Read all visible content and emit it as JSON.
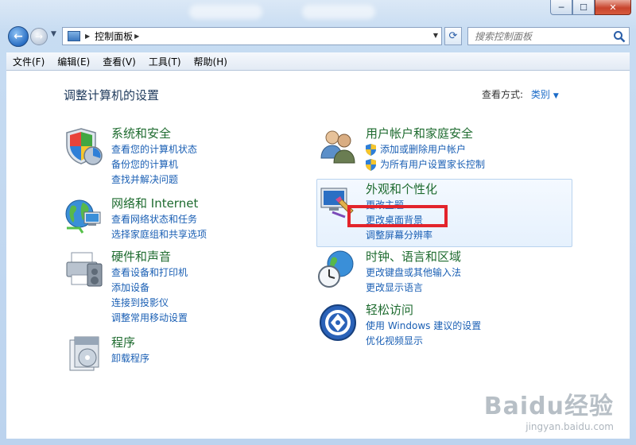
{
  "window": {
    "controls": {
      "minimize": "─",
      "maximize": "☐",
      "close": "✕"
    }
  },
  "address_bar": {
    "crumb": "控制面板",
    "search_placeholder": "搜索控制面板"
  },
  "menu": [
    "文件(F)",
    "编辑(E)",
    "查看(V)",
    "工具(T)",
    "帮助(H)"
  ],
  "page": {
    "title": "调整计算机的设置",
    "view_by_label": "查看方式:",
    "view_by_value": "类别"
  },
  "categories_left": [
    {
      "title": "系统和安全",
      "icon": "shield-security-icon",
      "links": [
        "查看您的计算机状态",
        "备份您的计算机",
        "查找并解决问题"
      ]
    },
    {
      "title": "网络和 Internet",
      "icon": "network-globe-icon",
      "links": [
        "查看网络状态和任务",
        "选择家庭组和共享选项"
      ]
    },
    {
      "title": "硬件和声音",
      "icon": "printer-hardware-icon",
      "links": [
        "查看设备和打印机",
        "添加设备",
        "连接到投影仪",
        "调整常用移动设置"
      ]
    },
    {
      "title": "程序",
      "icon": "programs-icon",
      "links": [
        "卸载程序"
      ]
    }
  ],
  "categories_right": [
    {
      "title": "用户帐户和家庭安全",
      "icon": "users-icon",
      "links": [
        "添加或删除用户帐户",
        "为所有用户设置家长控制"
      ]
    },
    {
      "title": "外观和个性化",
      "icon": "appearance-monitor-icon",
      "links": [
        "更改主题",
        "更改桌面背景",
        "调整屏幕分辨率"
      ]
    },
    {
      "title": "时钟、语言和区域",
      "icon": "clock-globe-icon",
      "links": [
        "更改键盘或其他输入法",
        "更改显示语言"
      ]
    },
    {
      "title": "轻松访问",
      "icon": "ease-of-access-icon",
      "links": [
        "使用 Windows 建议的设置",
        "优化视频显示"
      ]
    }
  ],
  "watermark": {
    "main": "Baidu经验",
    "sub": "jingyan.baidu.com"
  },
  "colors": {
    "category_title": "#1e6b2f",
    "link": "#1a5fb4",
    "highlight": "#e3242b"
  }
}
